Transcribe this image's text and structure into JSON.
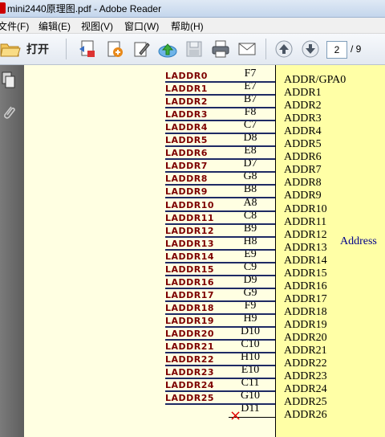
{
  "window": {
    "title": "mini2440原理图.pdf - Adobe Reader"
  },
  "menu": [
    "文件(F)",
    "编辑(E)",
    "视图(V)",
    "窗口(W)",
    "帮助(H)"
  ],
  "toolbar": {
    "open_label": "打开",
    "page_current": "2",
    "page_total": "/ 9",
    "icons": [
      "folder-open-icon",
      "create-pdf-icon",
      "attach-icon",
      "sign-icon",
      "upload-icon",
      "save-icon",
      "print-icon",
      "email-icon",
      "prev-page-icon",
      "next-page-icon"
    ]
  },
  "nav_icons": [
    "pages-icon",
    "attachments-icon"
  ],
  "schematic": {
    "component_name": "Address",
    "nets": [
      "LADDR0",
      "LADDR1",
      "LADDR2",
      "LADDR3",
      "LADDR4",
      "LADDR5",
      "LADDR6",
      "LADDR7",
      "LADDR8",
      "LADDR9",
      "LADDR10",
      "LADDR11",
      "LADDR12",
      "LADDR13",
      "LADDR14",
      "LADDR15",
      "LADDR16",
      "LADDR17",
      "LADDR18",
      "LADDR19",
      "LADDR20",
      "LADDR21",
      "LADDR22",
      "LADDR23",
      "LADDR24",
      "LADDR25"
    ],
    "balls": [
      "F7",
      "E7",
      "B7",
      "F8",
      "C7",
      "D8",
      "E8",
      "D7",
      "G8",
      "B8",
      "A8",
      "C8",
      "B9",
      "H8",
      "E9",
      "C9",
      "D9",
      "G9",
      "F9",
      "H9",
      "D10",
      "C10",
      "H10",
      "E10",
      "C11",
      "G10",
      "D11"
    ],
    "pins": [
      "ADDR/GPA0",
      "ADDR1",
      "ADDR2",
      "ADDR3",
      "ADDR4",
      "ADDR5",
      "ADDR6",
      "ADDR7",
      "ADDR8",
      "ADDR9",
      "ADDR10",
      "ADDR11",
      "ADDR12",
      "ADDR13",
      "ADDR14",
      "ADDR15",
      "ADDR16",
      "ADDR17",
      "ADDR18",
      "ADDR19",
      "ADDR20",
      "ADDR21",
      "ADDR22",
      "ADDR23",
      "ADDR24",
      "ADDR25",
      "ADDR26"
    ],
    "no_connect_mark": "×"
  }
}
